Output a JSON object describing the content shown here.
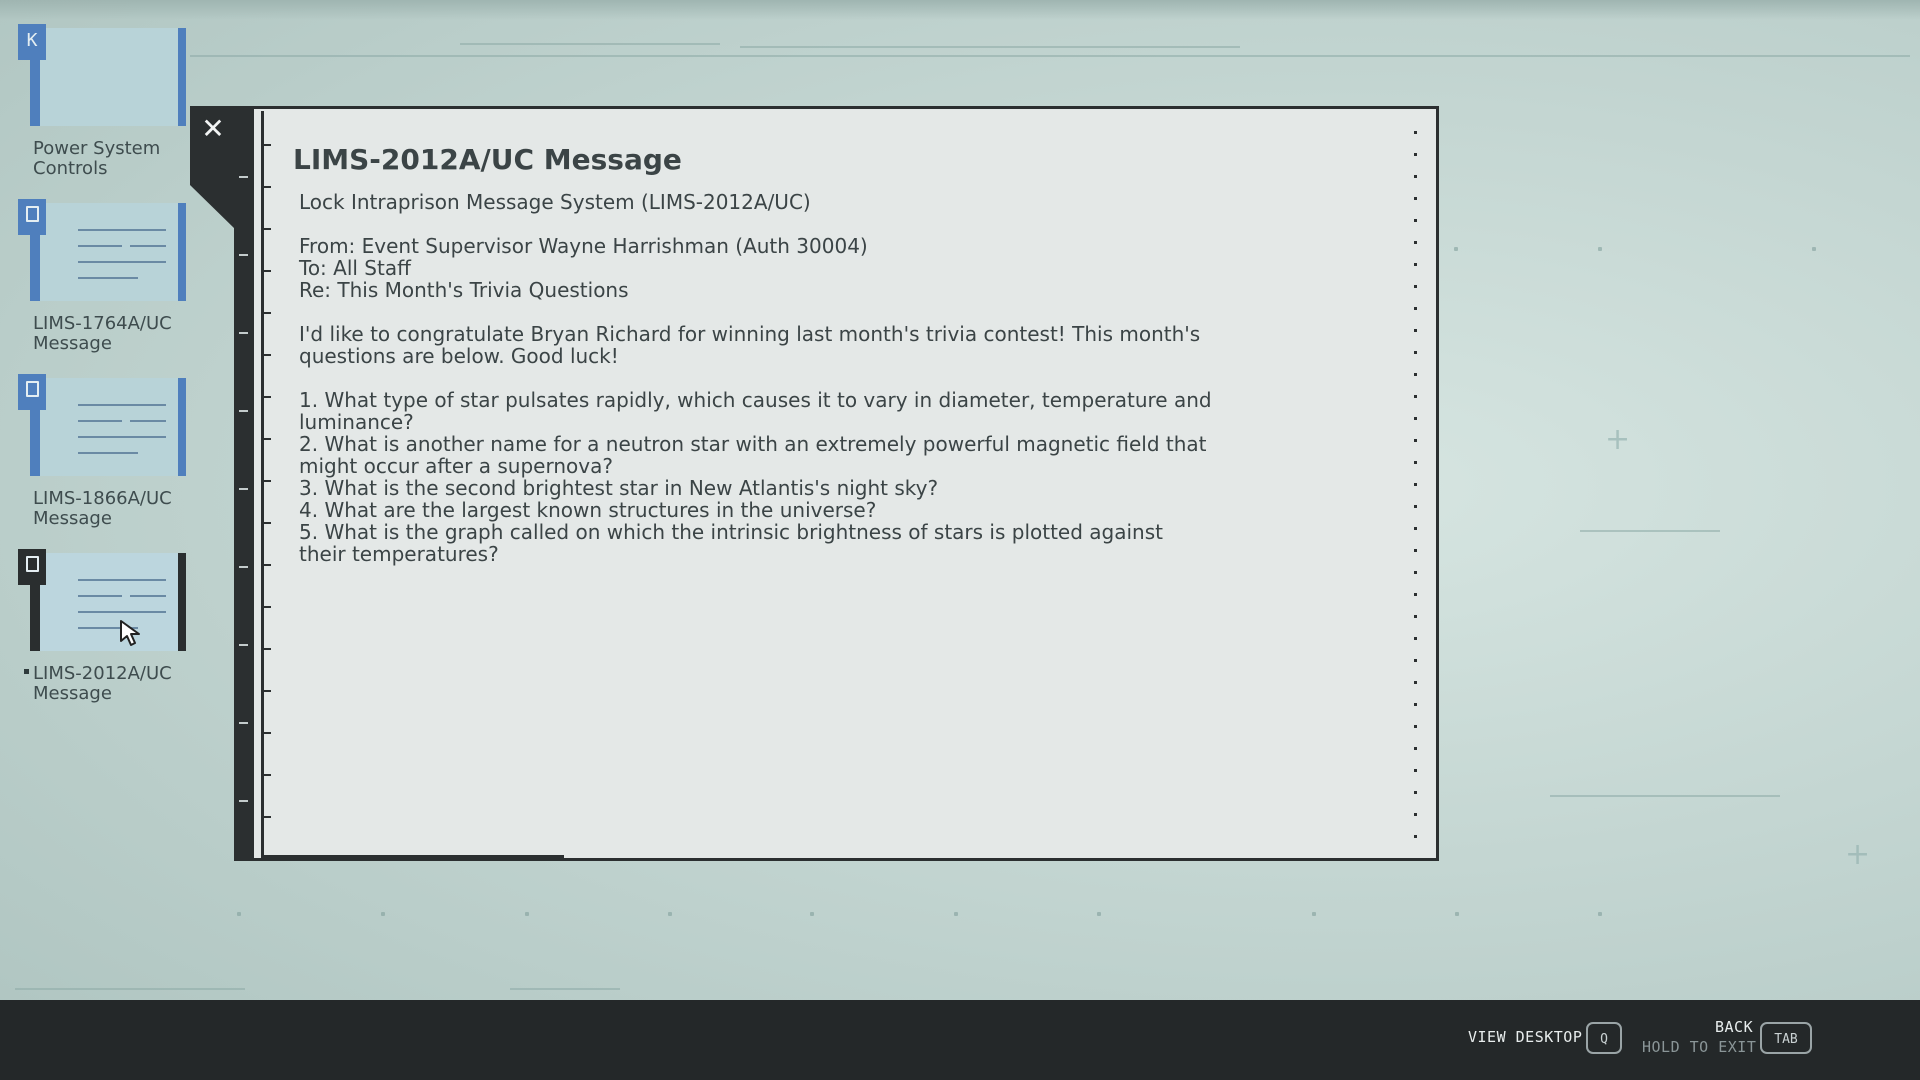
{
  "sidebar": {
    "items": [
      {
        "badge": "K",
        "label": "Power System Controls"
      },
      {
        "badge": "",
        "label": "LIMS-1764A/UC Message"
      },
      {
        "badge": "",
        "label": "LIMS-1866A/UC Message"
      },
      {
        "badge": "",
        "label": "LIMS-2012A/UC Message"
      }
    ]
  },
  "window": {
    "close_label": "✕",
    "title": "LIMS-2012A/UC Message",
    "system": "Lock Intraprison Message System (LIMS-2012A/UC)",
    "from": "From: Event Supervisor Wayne Harrishman (Auth 30004)",
    "to": "To: All Staff",
    "re": "Re: This Month's Trivia Questions",
    "intro_1": "I'd like to congratulate Bryan Richard for winning last month's trivia contest! This month's",
    "intro_2": "questions are below. Good luck!",
    "q1a": "1. What type of star pulsates rapidly, which causes it to vary in diameter, temperature and",
    "q1b": "luminance?",
    "q2a": "2. What is another name for a neutron star with an extremely powerful magnetic field that",
    "q2b": "might occur after a supernova?",
    "q3": "3. What is the second brightest star in New Atlantis's night sky?",
    "q4": "4. What are the largest known structures in the universe?",
    "q5a": "5. What is the graph called on which the intrinsic brightness of stars is plotted against",
    "q5b": "their temperatures?"
  },
  "footer": {
    "view_desktop": "VIEW DESKTOP",
    "view_desktop_key": "Q",
    "back": "BACK",
    "hold_to_exit": "HOLD TO EXIT",
    "back_key": "TAB"
  },
  "colors": {
    "accent": "#4f7fbd",
    "panel_dark": "#2b2f30",
    "window_bg": "#e4e8e7",
    "bottom_bar": "#242829"
  }
}
